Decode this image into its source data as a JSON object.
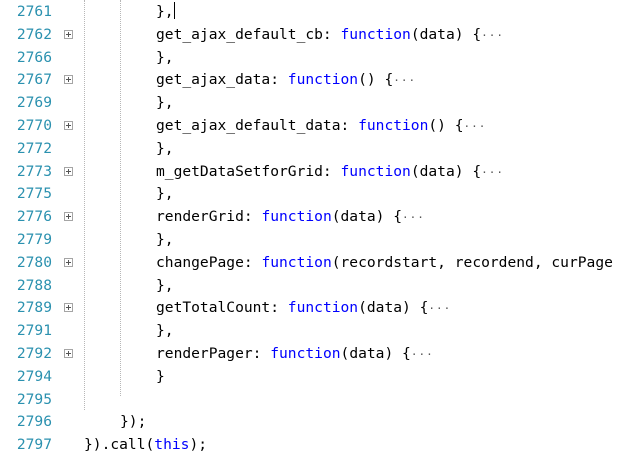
{
  "editor": {
    "lines": [
      {
        "number": "2761",
        "fold": false,
        "code": "},",
        "cursor": true
      },
      {
        "number": "2762",
        "fold": true,
        "name": "get_ajax_default_cb",
        "keyword": "function",
        "params": "(data) {"
      },
      {
        "number": "2766",
        "fold": false,
        "code": "},"
      },
      {
        "number": "2767",
        "fold": true,
        "name": "get_ajax_data",
        "keyword": "function",
        "params": "() {"
      },
      {
        "number": "2769",
        "fold": false,
        "code": "},"
      },
      {
        "number": "2770",
        "fold": true,
        "name": "get_ajax_default_data",
        "keyword": "function",
        "params": "() {"
      },
      {
        "number": "2772",
        "fold": false,
        "code": "},"
      },
      {
        "number": "2773",
        "fold": true,
        "name": "m_getDataSetforGrid",
        "keyword": "function",
        "params": "(data) {"
      },
      {
        "number": "2775",
        "fold": false,
        "code": "},"
      },
      {
        "number": "2776",
        "fold": true,
        "name": "renderGrid",
        "keyword": "function",
        "params": "(data) {"
      },
      {
        "number": "2779",
        "fold": false,
        "code": "},"
      },
      {
        "number": "2780",
        "fold": true,
        "name": "changePage",
        "keyword": "function",
        "params": "(recordstart, recordend, curPage"
      },
      {
        "number": "2788",
        "fold": false,
        "code": "},"
      },
      {
        "number": "2789",
        "fold": true,
        "name": "getTotalCount",
        "keyword": "function",
        "params": "(data) {"
      },
      {
        "number": "2791",
        "fold": false,
        "code": "},"
      },
      {
        "number": "2792",
        "fold": true,
        "name": "renderPager",
        "keyword": "function",
        "params": "(data) {"
      },
      {
        "number": "2794",
        "fold": false,
        "code": "}"
      },
      {
        "number": "2795",
        "fold": false,
        "code": ""
      },
      {
        "number": "2796",
        "fold": false,
        "code": "});"
      },
      {
        "number": "2797",
        "fold": false,
        "code": "}).call(",
        "keyword": "this",
        "tail": ");"
      }
    ],
    "collapsed_marker": "···",
    "colors": {
      "line_number": "#2b91af",
      "keyword": "#0000ff",
      "text": "#000000",
      "background": "#ffffff"
    }
  }
}
